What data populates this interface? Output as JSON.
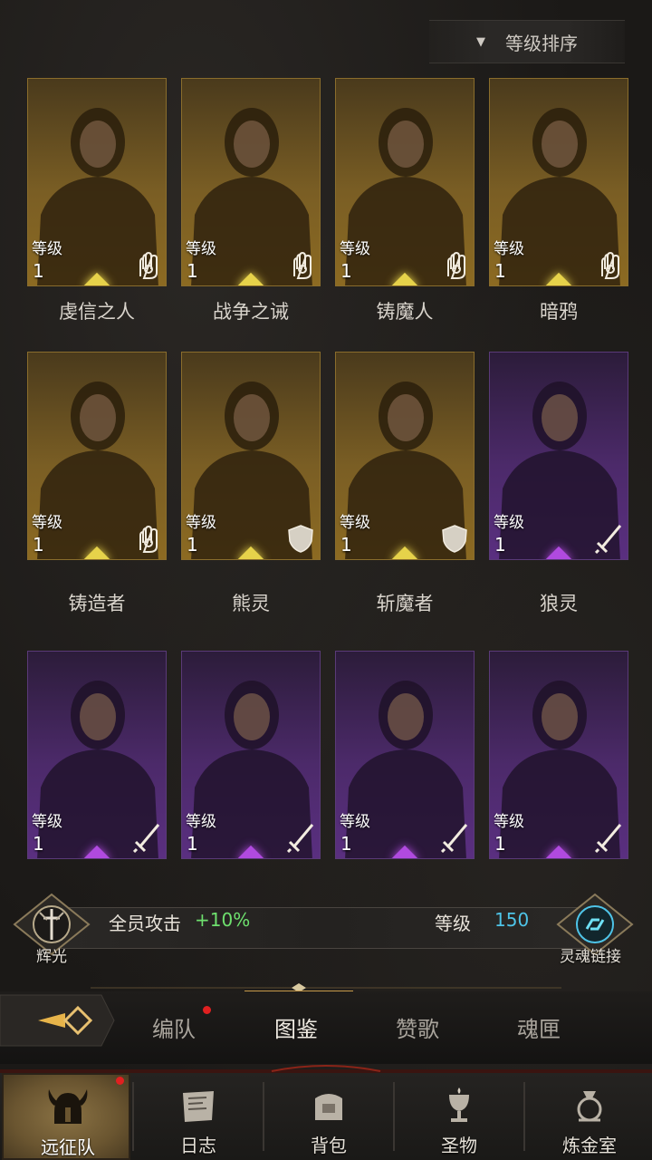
{
  "sort": {
    "label": "等级排序"
  },
  "heroes": [
    {
      "name": "虔信之人",
      "level_label": "等级",
      "level": "1",
      "rarity": "gold",
      "class_icon": "hand-icon"
    },
    {
      "name": "战争之诫",
      "level_label": "等级",
      "level": "1",
      "rarity": "gold",
      "class_icon": "hand-icon"
    },
    {
      "name": "铸魔人",
      "level_label": "等级",
      "level": "1",
      "rarity": "gold",
      "class_icon": "hand-icon"
    },
    {
      "name": "暗鸦",
      "level_label": "等级",
      "level": "1",
      "rarity": "gold",
      "class_icon": "hand-icon"
    },
    {
      "name": "铸造者",
      "level_label": "等级",
      "level": "1",
      "rarity": "gold",
      "class_icon": "hand-icon"
    },
    {
      "name": "熊灵",
      "level_label": "等级",
      "level": "1",
      "rarity": "gold",
      "class_icon": "shield-icon"
    },
    {
      "name": "斩魔者",
      "level_label": "等级",
      "level": "1",
      "rarity": "gold",
      "class_icon": "shield-icon"
    },
    {
      "name": "狼灵",
      "level_label": "等级",
      "level": "1",
      "rarity": "purple",
      "class_icon": "sword-icon"
    },
    {
      "name": "",
      "level_label": "等级",
      "level": "1",
      "rarity": "purple",
      "class_icon": "sword-icon"
    },
    {
      "name": "",
      "level_label": "等级",
      "level": "1",
      "rarity": "purple",
      "class_icon": "sword-icon"
    },
    {
      "name": "",
      "level_label": "等级",
      "level": "1",
      "rarity": "purple",
      "class_icon": "sword-icon"
    },
    {
      "name": "",
      "level_label": "等级",
      "level": "1",
      "rarity": "purple",
      "class_icon": "sword-icon"
    }
  ],
  "glory": {
    "left_label": "辉光",
    "stat_text": "全员攻击",
    "stat_bonus": "+10%",
    "level_label": "等级",
    "level_value": "150",
    "right_label": "灵魂链接",
    "bonus_color": "#6ee06e",
    "level_color": "#4ec4e8"
  },
  "subtabs": {
    "items": [
      "编队",
      "图鉴",
      "赞歌",
      "魂匣"
    ],
    "active": "图鉴"
  },
  "nav": {
    "items": [
      "远征队",
      "日志",
      "背包",
      "圣物",
      "炼金室"
    ],
    "active": "远征队"
  }
}
